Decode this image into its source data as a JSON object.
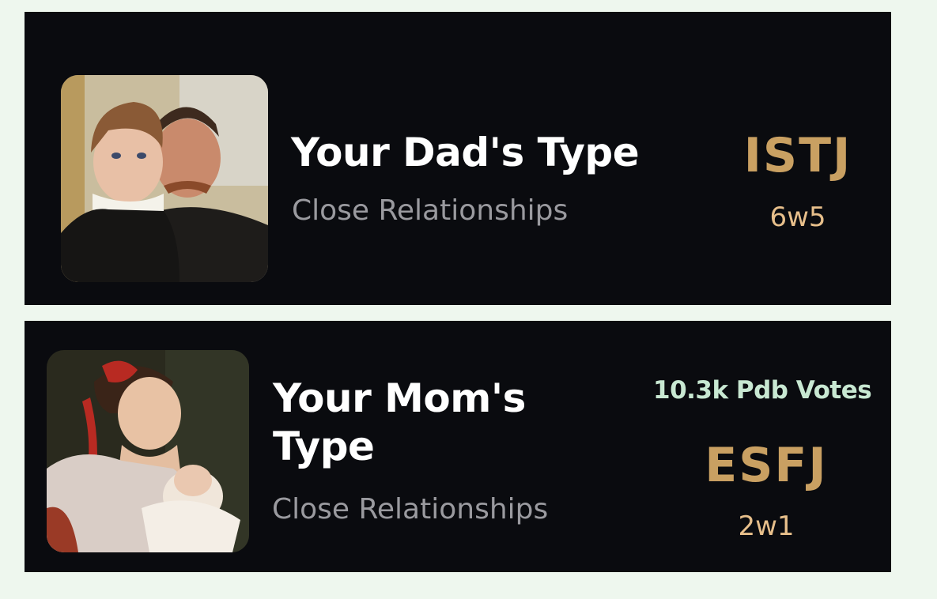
{
  "cards": [
    {
      "title": "Your Dad's Type",
      "subtitle": "Close Relationships",
      "type_code": "ISTJ",
      "wing": "6w5",
      "image_icon": "portrait-painting-father-son"
    },
    {
      "title": "Your Mom's Type",
      "subtitle": "Close Relationships",
      "votes": "10.3k Pdb Votes",
      "type_code": "ESFJ",
      "wing": "2w1",
      "image_icon": "portrait-painting-mother-baby"
    }
  ],
  "colors": {
    "page_bg": "#eef7ee",
    "card_bg": "#0a0b0f",
    "type_code": "#c9a062",
    "wing": "#e7bf8b",
    "votes": "#c8e8d2",
    "subtitle": "#9a9a9f"
  }
}
